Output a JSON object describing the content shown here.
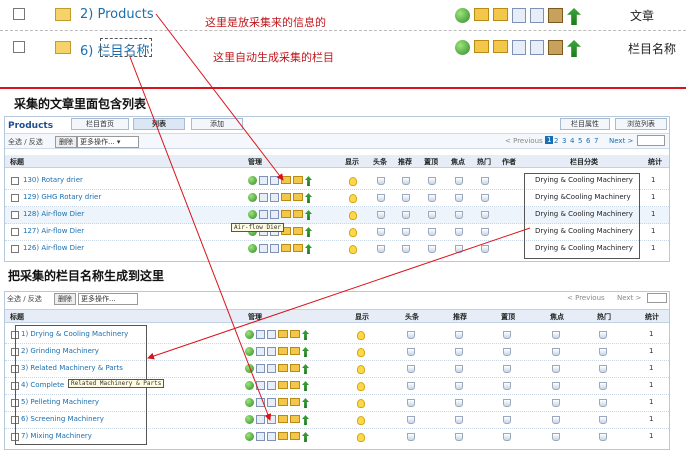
{
  "top_rows": [
    {
      "label": "2) Products",
      "right": "文章"
    },
    {
      "label": "6) 栏目名称",
      "right": "栏目名称"
    }
  ],
  "notes": {
    "a": "这里是放采集来的信息的",
    "b": "这里自动生成采集的栏目",
    "c": "采集的文章里面包含列表",
    "d": "把采集的栏目名称生成到这里"
  },
  "panel1": {
    "title": "Products",
    "tabs": [
      "栏目首页",
      "列表",
      "添加"
    ],
    "right_btns": [
      "栏目属性",
      "浏览列表"
    ],
    "select_all": "全选 / 反选",
    "delete_btn": "删除",
    "more_ops": "更多操作...",
    "pager_prev": "< Previous",
    "pages": [
      "1",
      "2",
      "3",
      "4",
      "5",
      "6",
      "7"
    ],
    "pager_next": "Next >",
    "headers": [
      "标题",
      "管理",
      "显示",
      "头条",
      "推荐",
      "置顶",
      "焦点",
      "热门",
      "作者",
      "栏目分类",
      "统计"
    ],
    "rows": [
      {
        "title": "130) Rotary drier",
        "category": "Drying & Cooling Machinery",
        "count": "1"
      },
      {
        "title": "129) GHG Rotary drier",
        "category": "Drying &Cooling Machinery",
        "count": "1"
      },
      {
        "title": "128) Air-flow Dier",
        "category": "Drying & Cooling Machinery",
        "count": "1"
      },
      {
        "title": "127) Air-flow Dier",
        "category": "Drying & Cooling Machinery",
        "count": "1"
      },
      {
        "title": "126) Air-flow Dier",
        "category": "Drying & Cooling Machinery",
        "count": "1"
      }
    ],
    "tooltip": "Air-flow Dier"
  },
  "panel2": {
    "select_all": "全选 / 反选",
    "delete_btn": "删除",
    "more_ops": "更多操作...",
    "pager_prev": "< Previous",
    "pager_next": "Next >",
    "headers": [
      "标题",
      "管理",
      "显示",
      "头条",
      "推荐",
      "置顶",
      "焦点",
      "热门",
      "统计"
    ],
    "rows": [
      {
        "title": "1) Drying & Cooling Machinery",
        "count": "1"
      },
      {
        "title": "2) Grinding Machinery",
        "count": "1"
      },
      {
        "title": "3) Related Machinery & Parts",
        "count": "1"
      },
      {
        "title": "4) Complete",
        "count": "1"
      },
      {
        "title": "5) Pelleting Machinery",
        "count": "1"
      },
      {
        "title": "6) Screening Machinery",
        "count": "1"
      },
      {
        "title": "7) Mixing Machinery",
        "count": "1"
      }
    ],
    "tooltip": "Related Machinery & Parts"
  },
  "colors": {
    "red": "#d9131b",
    "link": "#1a6fb0",
    "header_bg": "#e6edf6"
  }
}
